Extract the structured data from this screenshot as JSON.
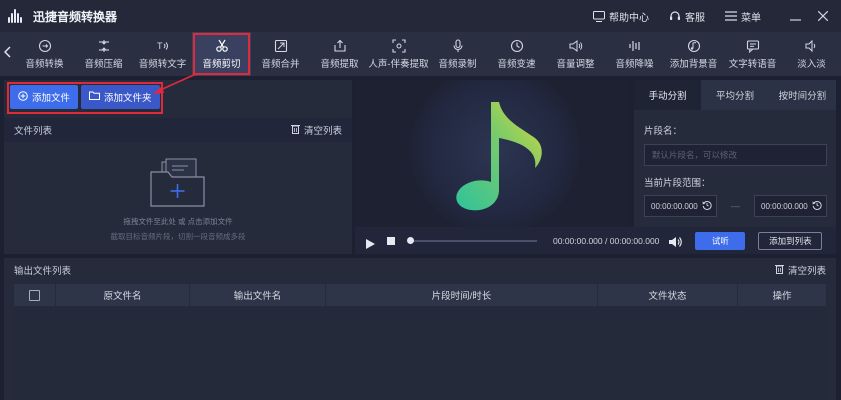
{
  "app": {
    "title": "迅捷音频转换器"
  },
  "titlebar": {
    "help_label": "帮助中心",
    "service_label": "客服",
    "menu_label": "菜单"
  },
  "toolbar": {
    "tools": [
      {
        "label": "音频转换",
        "icon": "audio-convert-icon"
      },
      {
        "label": "音频压缩",
        "icon": "audio-compress-icon"
      },
      {
        "label": "音频转文字",
        "icon": "audio-to-text-icon"
      },
      {
        "label": "音频剪切",
        "icon": "scissors-icon",
        "active": true
      },
      {
        "label": "音频合并",
        "icon": "merge-icon"
      },
      {
        "label": "音频提取",
        "icon": "extract-icon"
      },
      {
        "label": "人声-伴奏提取",
        "icon": "vocal-separate-icon"
      },
      {
        "label": "音频录制",
        "icon": "microphone-icon"
      },
      {
        "label": "音频变速",
        "icon": "speed-icon"
      },
      {
        "label": "音量调整",
        "icon": "volume-icon"
      },
      {
        "label": "音频降噪",
        "icon": "denoise-icon"
      },
      {
        "label": "添加背景音",
        "icon": "background-music-icon"
      },
      {
        "label": "文字转语音",
        "icon": "text-to-speech-icon"
      },
      {
        "label": "淡入淡",
        "icon": "fade-icon"
      }
    ]
  },
  "left": {
    "add_file": "添加文件",
    "add_folder": "添加文件夹",
    "file_list": "文件列表",
    "clear_list": "清空列表",
    "empty_hint1": "拖拽文件至此处 或 点击添加文件",
    "empty_hint2": "截取目标音频片段，切割一段音频成多段"
  },
  "player": {
    "current_time": "00:00:00.000",
    "separator": "/",
    "total_time": "00:00:00.000",
    "progress": 0,
    "try_label": "试听",
    "add_to_list": "添加到列表"
  },
  "right": {
    "tabs": [
      "手动分割",
      "平均分割",
      "按时间分割"
    ],
    "segment_name_label": "片段名：",
    "segment_name_placeholder": "默认片段名，可以修改",
    "range_label": "当前片段范围：",
    "range_start": "00:00:00.000",
    "range_end": "00:00:00.000",
    "range_dash": "—"
  },
  "output": {
    "title": "输出文件列表",
    "clear_list": "清空列表",
    "columns": [
      "原文件名",
      "输出文件名",
      "片段时间/时长",
      "文件状态",
      "操作"
    ]
  },
  "colors": {
    "accent_blue": "#3d6dea",
    "highlight_red": "#e02a3a",
    "note_green": "#2fc39a",
    "note_yellow": "#d8d83a"
  }
}
